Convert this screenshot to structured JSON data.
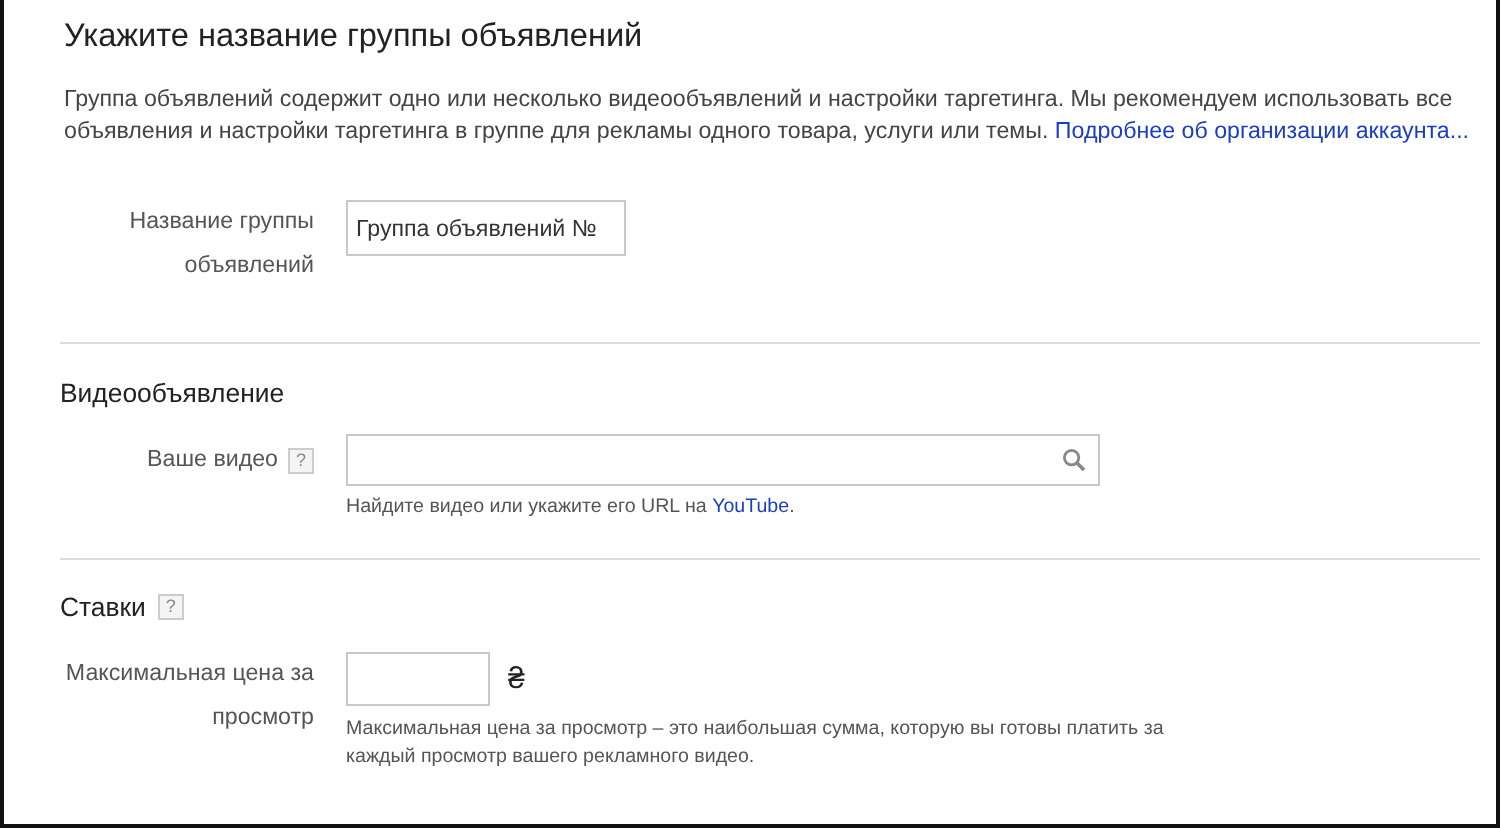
{
  "title": "Укажите название группы объявлений",
  "description": {
    "text": "Группа объявлений содержит одно или несколько видеообъявлений и настройки таргетинга. Мы рекомендуем использовать все объявления и настройки таргетинга в группе для рекламы одного товара, услуги или темы.",
    "link": "Подробнее об организации аккаунта..."
  },
  "name_field": {
    "label": "Название группы объявлений",
    "value": "Группа объявлений №"
  },
  "video_section": {
    "heading": "Видеообъявление",
    "label": "Ваше видео",
    "help": "?",
    "hint": "Найдите видео или укажите его URL на",
    "hint_link": "YouTube",
    "hint_end": "."
  },
  "bids_section": {
    "heading": "Ставки",
    "help": "?",
    "label": "Максимальная цена за просмотр",
    "currency": "₴",
    "hint": "Максимальная цена за просмотр – это наибольшая сумма, которую вы готовы платить за каждый просмотр вашего рекламного видео."
  }
}
